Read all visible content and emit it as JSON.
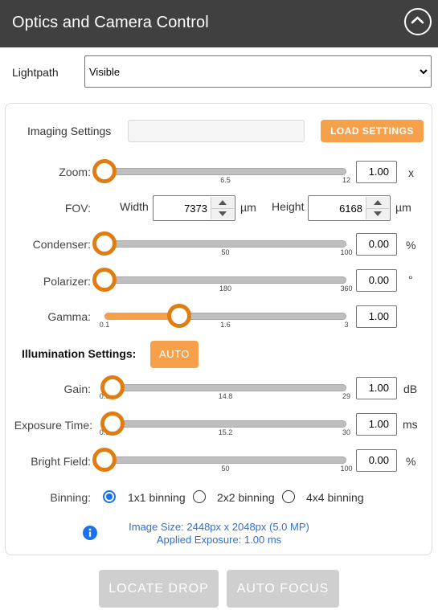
{
  "header": {
    "title": "Optics and Camera Control",
    "collapse_icon": "chevron-up-icon"
  },
  "lightpath": {
    "label": "Lightpath",
    "selected": "Visible"
  },
  "imaging": {
    "label": "Imaging Settings",
    "input_value": "",
    "load_button": "LOAD SETTINGS"
  },
  "zoom": {
    "label": "Zoom:",
    "ticks": [
      "1",
      "6.5",
      "12"
    ],
    "value": "1.00",
    "unit": "x",
    "min": 1,
    "max": 12,
    "current": 1
  },
  "fov": {
    "label": "FOV:",
    "width_label": "Width",
    "width_value": "7373",
    "width_unit": "µm",
    "height_label": "Height",
    "height_value": "6168",
    "height_unit": "µm"
  },
  "condenser": {
    "label": "Condenser:",
    "ticks": [
      "0",
      "50",
      "100"
    ],
    "value": "0.00",
    "unit": "%",
    "min": 0,
    "max": 100,
    "current": 0
  },
  "polarizer": {
    "label": "Polarizer:",
    "ticks": [
      "0",
      "180",
      "360"
    ],
    "value": "0.00",
    "unit": "°",
    "min": 0,
    "max": 360,
    "current": 0
  },
  "gamma": {
    "label": "Gamma:",
    "ticks": [
      "0.1",
      "1.6",
      "3"
    ],
    "value": "1.00",
    "unit": "",
    "min": 0.1,
    "max": 3,
    "current": 1.0
  },
  "illumination": {
    "label": "Illumination Settings:",
    "auto_button": "AUTO"
  },
  "gain": {
    "label": "Gain:",
    "ticks": [
      "0.0",
      "14.8",
      "29"
    ],
    "value": "1.00",
    "unit": "dB",
    "min": 0,
    "max": 29,
    "current": 1
  },
  "exposure": {
    "label": "Exposure Time:",
    "ticks": [
      "0.0",
      "15.2",
      "30"
    ],
    "value": "1.00",
    "unit": "ms",
    "min": 0,
    "max": 30,
    "current": 1
  },
  "brightfield": {
    "label": "Bright Field:",
    "ticks": [
      "0",
      "50",
      "100"
    ],
    "value": "0.00",
    "unit": "%",
    "min": 0,
    "max": 100,
    "current": 0
  },
  "binning": {
    "label": "Binning:",
    "options": [
      "1x1 binning",
      "2x2 binning",
      "4x4 binning"
    ],
    "selected_index": 0
  },
  "info": {
    "icon": "info-icon",
    "image_size": "Image Size: 2448px x 2048px (5.0 MP)",
    "applied_exposure": "Applied Exposure: 1.00 ms"
  },
  "footer": {
    "locate_drop": "LOCATE DROP",
    "auto_focus": "AUTO FOCUS"
  },
  "colors": {
    "header_bg": "#404040",
    "accent": "#f7a04a",
    "thumb_ring": "#e07d12",
    "info_blue": "#2f6fd6",
    "disabled": "#cfcfcf"
  }
}
